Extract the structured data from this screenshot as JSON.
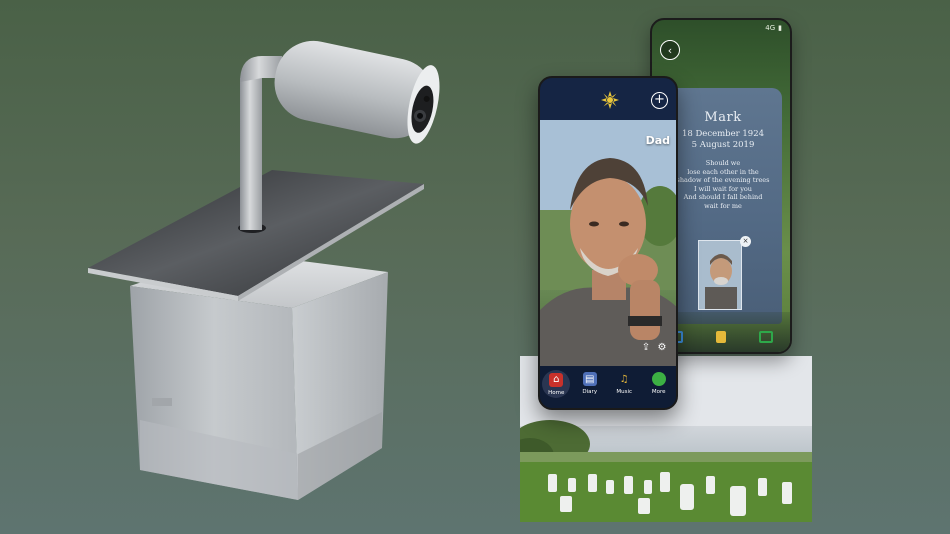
{
  "front_phone": {
    "profile_name": "Dad",
    "nav": [
      {
        "label": "Home",
        "icon": "home-icon"
      },
      {
        "label": "Diary",
        "icon": "diary-icon"
      },
      {
        "label": "Music",
        "icon": "music-note-icon"
      },
      {
        "label": "More",
        "icon": "more-icon"
      }
    ],
    "add_glyph": "+"
  },
  "back_phone": {
    "status": "4G",
    "back_glyph": "‹",
    "memorial": {
      "name": "Mark",
      "birth_date": "18 December 1924",
      "death_date": "5 August 2019",
      "poem": [
        "Should we",
        "lose each other in the",
        "shadow of the evening trees",
        "I will wait for you",
        "And should I fall behind",
        "wait for me"
      ]
    },
    "close_glyph": "×"
  },
  "colors": {
    "background_top": "#4a6147",
    "background_bottom": "#5e7470",
    "front_phone_bg": "#0f1c35",
    "headstone": "#5f7690",
    "home_red": "#c8312b",
    "more_green": "#3cb043",
    "camera_blue": "#3a8ad6",
    "speaker_yellow": "#e5b93a",
    "video_green": "#2ea84a"
  }
}
